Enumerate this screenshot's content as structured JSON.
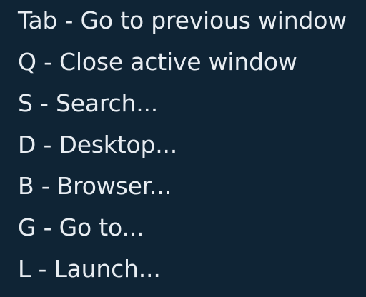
{
  "shortcuts": [
    {
      "label": "Tab - Go to previous window"
    },
    {
      "label": "Q - Close active window"
    },
    {
      "label": "S - Search..."
    },
    {
      "label": "D - Desktop..."
    },
    {
      "label": "B - Browser..."
    },
    {
      "label": "G - Go to..."
    },
    {
      "label": "L - Launch..."
    }
  ]
}
